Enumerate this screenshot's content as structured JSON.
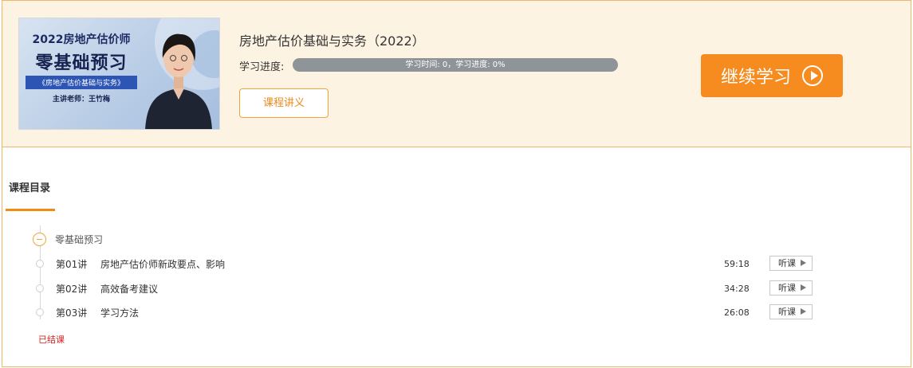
{
  "course": {
    "cover": {
      "title_line1": "2022房地产估价师",
      "title_line2": "零基础预习",
      "subject": "《房地产估价基础与实务》",
      "teacher_line": "主讲老师：王竹梅"
    },
    "title": "房地产估价基础与实务（2022）",
    "progress_label": "学习进度:",
    "progress_text": "学习时间: 0，学习进度: 0%",
    "progress_fraction": 0,
    "lecture_button": "课程讲义",
    "continue_button": "继续学习"
  },
  "catalog": {
    "tab_label": "课程目录",
    "chapter": "零基础预习",
    "lessons": [
      {
        "num": "第01讲",
        "title": "房地产估价师新政要点、影响",
        "duration": "59:18",
        "action": "听课"
      },
      {
        "num": "第02讲",
        "title": "高效备考建议",
        "duration": "34:28",
        "action": "听课"
      },
      {
        "num": "第03讲",
        "title": "学习方法",
        "duration": "26:08",
        "action": "听课"
      }
    ],
    "status": "已结课"
  },
  "colors": {
    "accent": "#f68b1f",
    "header_bg": "#fdf3e3",
    "border": "#eeb86a",
    "progress_track": "#8f9499",
    "status_red": "#e02020"
  }
}
